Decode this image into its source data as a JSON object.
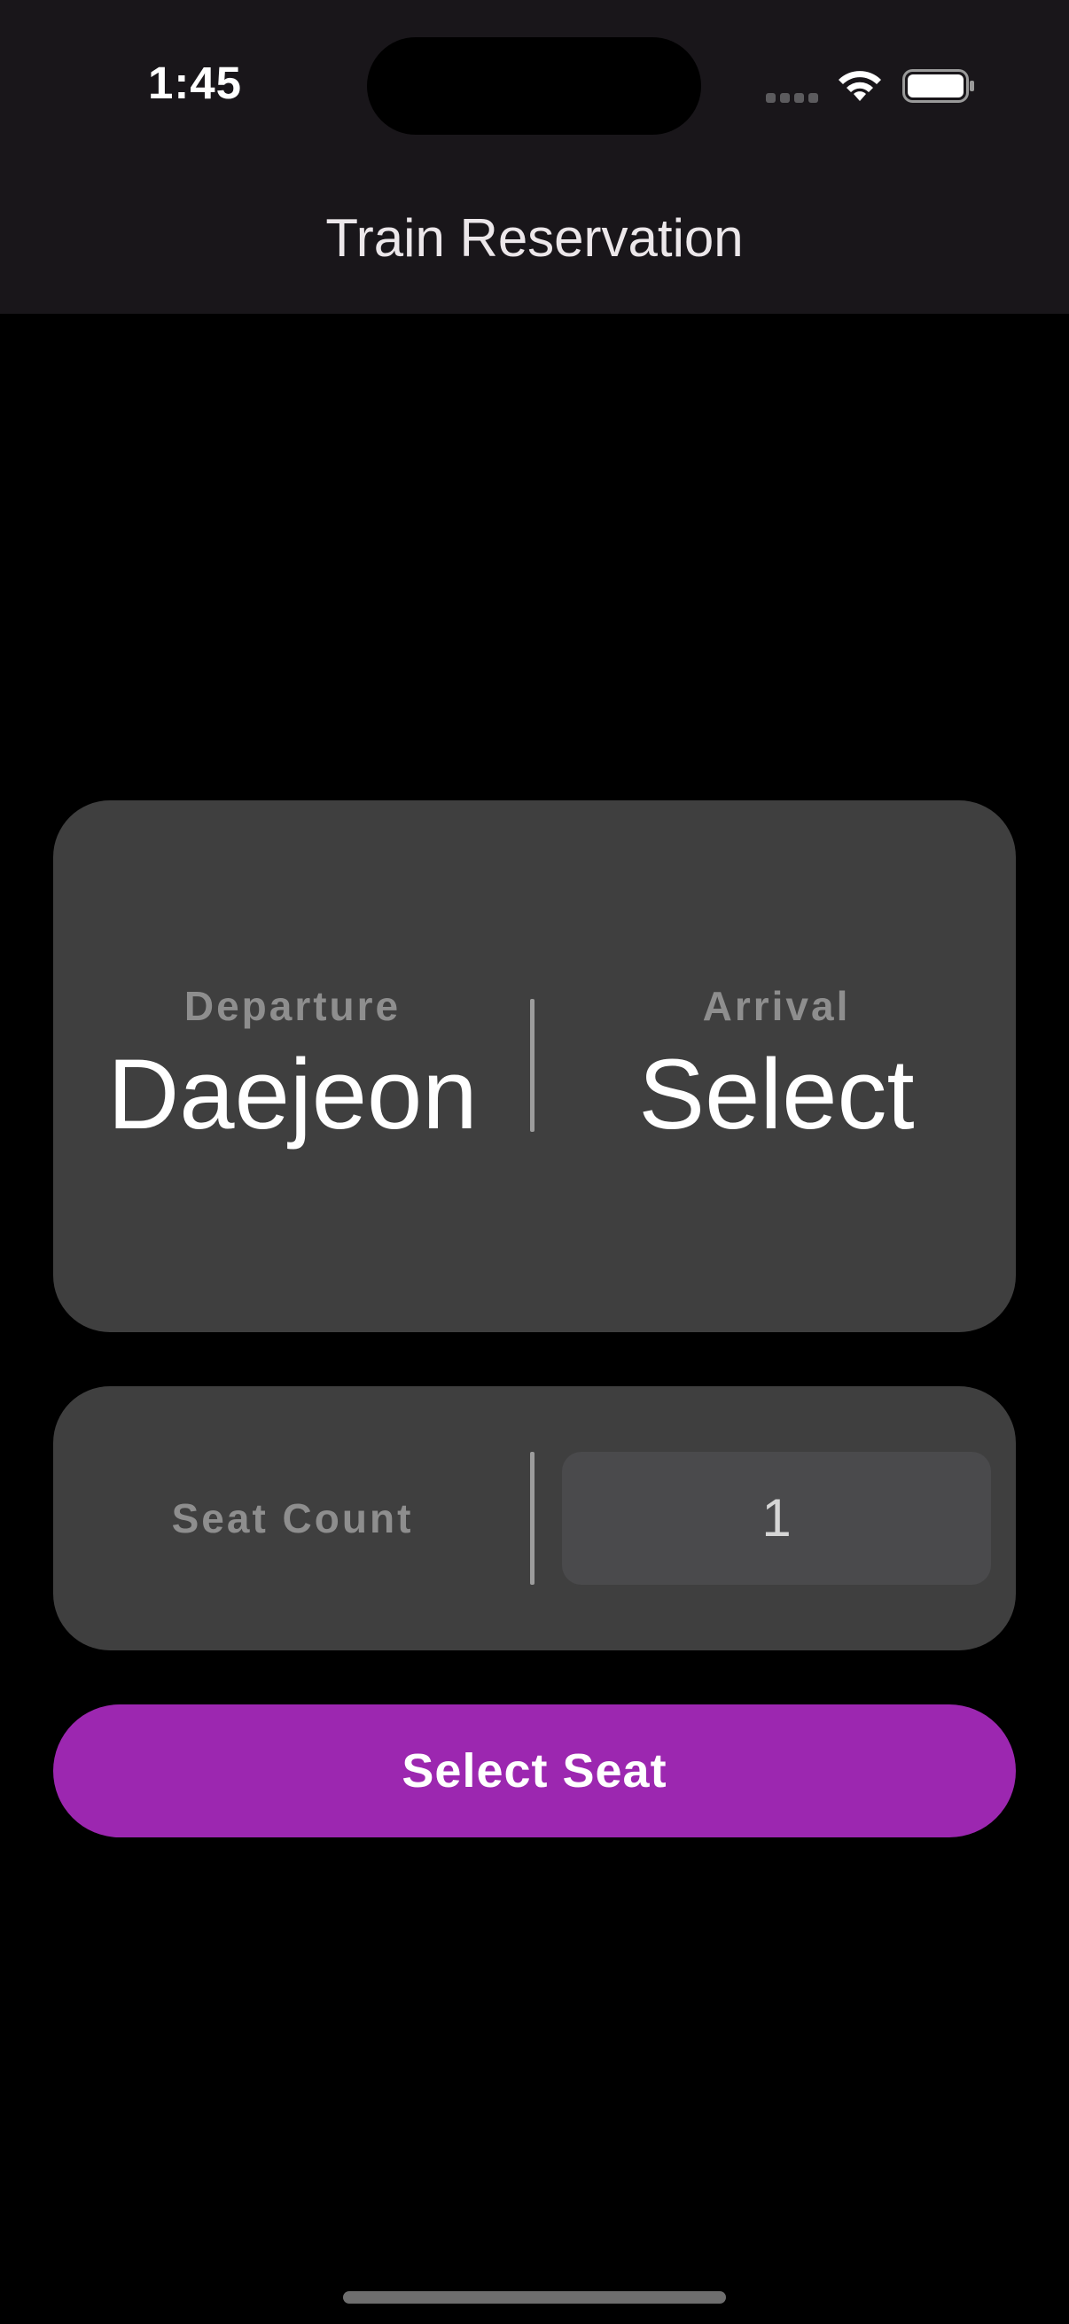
{
  "status_bar": {
    "time": "1:45",
    "icons": [
      "cellular-signal-icon",
      "wifi-icon",
      "battery-icon"
    ]
  },
  "nav": {
    "title": "Train Reservation"
  },
  "stations": {
    "departure_label": "Departure",
    "departure_value": "Daejeon",
    "arrival_label": "Arrival",
    "arrival_value": "Select"
  },
  "seats": {
    "label": "Seat Count",
    "value": "1"
  },
  "actions": {
    "select_seat_label": "Select Seat"
  },
  "colors": {
    "background": "#000000",
    "top_bar": "#19161a",
    "card": "#3f3f3f",
    "accent": "#9c27b0",
    "muted_label": "#8e8e8e"
  }
}
